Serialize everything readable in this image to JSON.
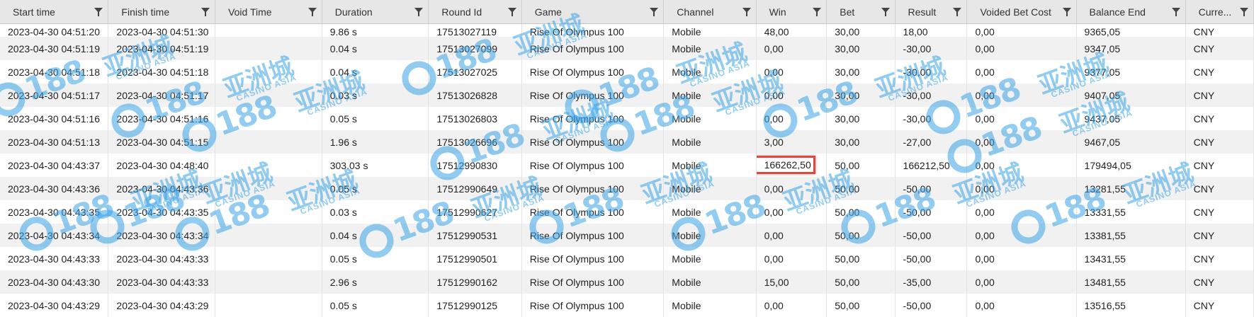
{
  "columns": [
    "Start time",
    "Finish time",
    "Void Time",
    "Duration",
    "Round Id",
    "Game",
    "Channel",
    "Win",
    "Bet",
    "Result",
    "Voided Bet Cost",
    "Balance End",
    "Curre..."
  ],
  "rows": [
    [
      "2023-04-30 04:51:20",
      "2023-04-30 04:51:30",
      "",
      "9.86 s",
      "17513027119",
      "Rise Of Olympus 100",
      "Mobile",
      "48,00",
      "30,00",
      "18,00",
      "0,00",
      "9365,05",
      "CNY"
    ],
    [
      "2023-04-30 04:51:19",
      "2023-04-30 04:51:19",
      "",
      "0.04 s",
      "17513027099",
      "Rise Of Olympus 100",
      "Mobile",
      "0,00",
      "30,00",
      "-30,00",
      "0,00",
      "9347,05",
      "CNY"
    ],
    [
      "2023-04-30 04:51:18",
      "2023-04-30 04:51:18",
      "",
      "0.04 s",
      "17513027025",
      "Rise Of Olympus 100",
      "Mobile",
      "0,00",
      "30,00",
      "-30,00",
      "0,00",
      "9377,05",
      "CNY"
    ],
    [
      "2023-04-30 04:51:17",
      "2023-04-30 04:51:17",
      "",
      "0.03 s",
      "17513026828",
      "Rise Of Olympus 100",
      "Mobile",
      "0,00",
      "30,00",
      "-30,00",
      "0,00",
      "9407,05",
      "CNY"
    ],
    [
      "2023-04-30 04:51:16",
      "2023-04-30 04:51:16",
      "",
      "0.05 s",
      "17513026803",
      "Rise Of Olympus 100",
      "Mobile",
      "0,00",
      "30,00",
      "-30,00",
      "0,00",
      "9437,05",
      "CNY"
    ],
    [
      "2023-04-30 04:51:13",
      "2023-04-30 04:51:15",
      "",
      "1.96 s",
      "17513026696",
      "Rise Of Olympus 100",
      "Mobile",
      "3,00",
      "30,00",
      "-27,00",
      "0,00",
      "9467,05",
      "CNY"
    ],
    [
      "2023-04-30 04:43:37",
      "2023-04-30 04:48:40",
      "",
      "303.03 s",
      "17512990830",
      "Rise Of Olympus 100",
      "Mobile",
      "166262,50",
      "50,00",
      "166212,50",
      "0,00",
      "179494,05",
      "CNY"
    ],
    [
      "2023-04-30 04:43:36",
      "2023-04-30 04:43:36",
      "",
      "0.05 s",
      "17512990649",
      "Rise Of Olympus 100",
      "Mobile",
      "0,00",
      "50,00",
      "-50,00",
      "0,00",
      "13281,55",
      "CNY"
    ],
    [
      "2023-04-30 04:43:35",
      "2023-04-30 04:43:35",
      "",
      "0.03 s",
      "17512990627",
      "Rise Of Olympus 100",
      "Mobile",
      "0,00",
      "50,00",
      "-50,00",
      "0,00",
      "13331,55",
      "CNY"
    ],
    [
      "2023-04-30 04:43:34",
      "2023-04-30 04:43:34",
      "",
      "0.04 s",
      "17512990531",
      "Rise Of Olympus 100",
      "Mobile",
      "0,00",
      "50,00",
      "-50,00",
      "0,00",
      "13381,55",
      "CNY"
    ],
    [
      "2023-04-30 04:43:33",
      "2023-04-30 04:43:33",
      "",
      "0.05 s",
      "17512990501",
      "Rise Of Olympus 100",
      "Mobile",
      "0,00",
      "50,00",
      "-50,00",
      "0,00",
      "13431,55",
      "CNY"
    ],
    [
      "2023-04-30 04:43:30",
      "2023-04-30 04:43:33",
      "",
      "2.96 s",
      "17512990162",
      "Rise Of Olympus 100",
      "Mobile",
      "15,00",
      "50,00",
      "-35,00",
      "0,00",
      "13481,55",
      "CNY"
    ],
    [
      "2023-04-30 04:43:29",
      "2023-04-30 04:43:29",
      "",
      "0.05 s",
      "17512990125",
      "Rise Of Olympus 100",
      "Mobile",
      "0,00",
      "50,00",
      "-50,00",
      "0,00",
      "13516,55",
      "CNY"
    ]
  ],
  "highlight": {
    "row": 6,
    "col": 7
  },
  "watermark": {
    "text": "188",
    "text_cn": "亚洲城",
    "sub": "CASINO ASIA",
    "color": "#3aa3e6"
  },
  "colors": {
    "header_bg": "#e7e7e7",
    "row_alt": "#f1f1f1",
    "highlight_border": "#e2473d"
  }
}
